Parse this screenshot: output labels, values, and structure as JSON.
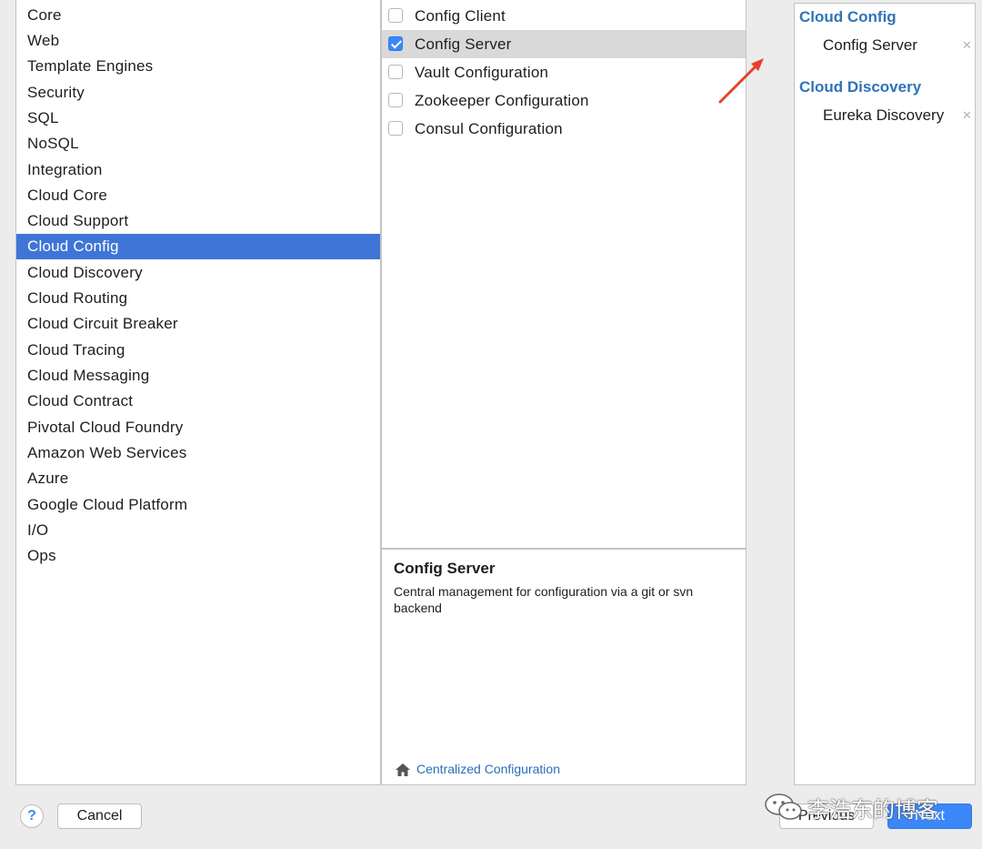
{
  "categories": {
    "items": [
      {
        "label": "Core"
      },
      {
        "label": "Web"
      },
      {
        "label": "Template Engines"
      },
      {
        "label": "Security"
      },
      {
        "label": "SQL"
      },
      {
        "label": "NoSQL"
      },
      {
        "label": "Integration"
      },
      {
        "label": "Cloud Core"
      },
      {
        "label": "Cloud Support"
      },
      {
        "label": "Cloud Config",
        "selected": true
      },
      {
        "label": "Cloud Discovery"
      },
      {
        "label": "Cloud Routing"
      },
      {
        "label": "Cloud Circuit Breaker"
      },
      {
        "label": "Cloud Tracing"
      },
      {
        "label": "Cloud Messaging"
      },
      {
        "label": "Cloud Contract"
      },
      {
        "label": "Pivotal Cloud Foundry"
      },
      {
        "label": "Amazon Web Services"
      },
      {
        "label": "Azure"
      },
      {
        "label": "Google Cloud Platform"
      },
      {
        "label": "I/O"
      },
      {
        "label": "Ops"
      }
    ]
  },
  "dependencies": {
    "items": [
      {
        "label": "Config Client",
        "checked": false
      },
      {
        "label": "Config Server",
        "checked": true,
        "selected": true
      },
      {
        "label": "Vault Configuration",
        "checked": false
      },
      {
        "label": "Zookeeper Configuration",
        "checked": false
      },
      {
        "label": "Consul Configuration",
        "checked": false
      }
    ]
  },
  "description": {
    "title": "Config Server",
    "text": "Central management for configuration via a git or svn backend",
    "link_icon": "home-icon",
    "link_label": "Centralized Configuration"
  },
  "selected": {
    "groups": [
      {
        "title": "Cloud Config",
        "items": [
          {
            "label": "Config Server",
            "remove_icon": "close-icon"
          }
        ]
      },
      {
        "title": "Cloud Discovery",
        "items": [
          {
            "label": "Eureka Discovery",
            "remove_icon": "close-icon"
          }
        ]
      }
    ]
  },
  "footer": {
    "help_label": "?",
    "cancel_label": "Cancel",
    "previous_label": "Previous",
    "next_label": "Next"
  },
  "watermark": {
    "text": "李浩东的博客",
    "icon": "wechat-icon"
  },
  "colors": {
    "selection": "#3f75d6",
    "accent": "#3b87f7",
    "group_title": "#2f73b8",
    "link": "#2a6ebb",
    "annotation_arrow": "#e8402a"
  }
}
